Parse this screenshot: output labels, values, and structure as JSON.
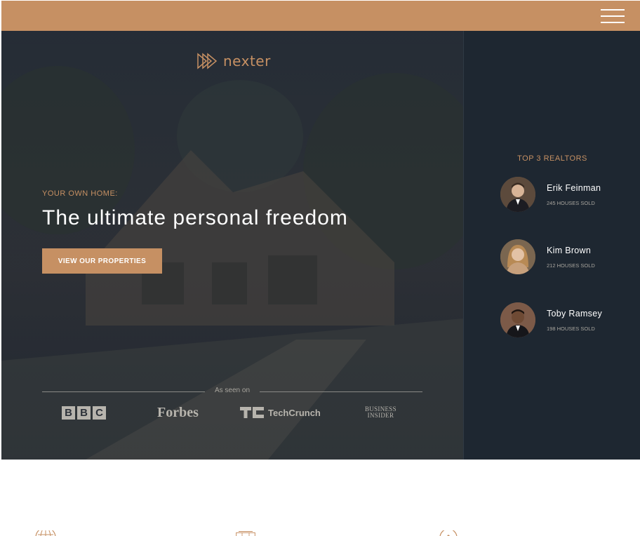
{
  "colors": {
    "accent": "#c69063",
    "sidebar_bg": "#1e2731",
    "text_light": "#ffffff",
    "muted": "#a8a59e"
  },
  "header": {
    "menu_icon": "hamburger-menu-icon"
  },
  "hero": {
    "logo_text": "nexter",
    "eyebrow": "YOUR OWN HOME:",
    "headline": "The ultimate personal freedom",
    "cta_label": "VIEW OUR PROPERTIES",
    "seen_on": "As seen on",
    "brands": {
      "bbc": [
        "B",
        "B",
        "C"
      ],
      "forbes": "Forbes",
      "techcrunch": "TechCrunch",
      "business_insider_1": "BUSINESS",
      "business_insider_2": "INSIDER"
    }
  },
  "sidebar": {
    "title": "TOP 3 REALTORS",
    "realtors": [
      {
        "name": "Erik Feinman",
        "sold": "245 HOUSES SOLD"
      },
      {
        "name": "Kim Brown",
        "sold": "212 HOUSES SOLD"
      },
      {
        "name": "Toby Ramsey",
        "sold": "198 HOUSES SOLD"
      }
    ]
  },
  "features": {
    "icons": [
      "globe-icon",
      "building-icon",
      "location-icon"
    ]
  }
}
